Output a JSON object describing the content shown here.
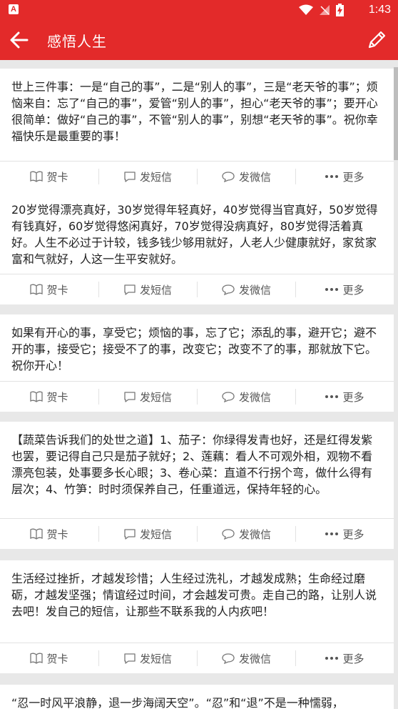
{
  "status_bar": {
    "app_badge": "A",
    "time": "1:43"
  },
  "app_bar": {
    "title": "感悟人生",
    "back_icon": "arrow-left-icon",
    "edit_icon": "pencil-icon"
  },
  "actions": {
    "card": "贺卡",
    "sms": "发短信",
    "wechat": "发微信",
    "more": "更多"
  },
  "posts": [
    {
      "text": "世上三件事：一是“自己的事”，二是“别人的事”，三是“老天爷的事”；烦恼来自：忘了“自己的事”，爱管“别人的事”，担心“老天爷的事”；要开心很简单：做好“自己的事”，不管“别人的事”，别想“老天爷的事”。祝你幸福快乐是最重要的事！"
    },
    {
      "text": "20岁觉得漂亮真好，30岁觉得年轻真好，40岁觉得当官真好，50岁觉得有钱真好，60岁觉得悠闲真好，70岁觉得没病真好，80岁觉得活着真好。人生不必过于计较，钱多钱少够用就好，人老人少健康就好，家贫家富和气就好，人这一生平安就好。"
    },
    {
      "text": "如果有开心的事，享受它；烦恼的事，忘了它；添乱的事，避开它；避不开的事，接受它；接受不了的事，改变它；改变不了的事，那就放下它。祝你开心！"
    },
    {
      "text": "【蔬菜告诉我们的处世之道】1、茄子：你绿得发青也好，还是红得发紫也罢，要记得自己只是茄子就好；2、莲藕：看人不可观外相，观物不看漂亮包装，处事要多长心眼；3、卷心菜：直道不行拐个弯，做什么得有层次；4、竹笋：时时须保养自己，任重道远，保持年轻的心。"
    },
    {
      "text": "生活经过挫折，才越发珍惜；人生经过洗礼，才越发成熟；生命经过磨砺，才越发坚强；情谊经过时间，才会越发可贵。走自己的路，让别人说去吧！发自己的短信，让那些不联系我的人内疚吧！"
    },
    {
      "text": "“忍一时风平浪静，退一步海阔天空”。“忍”和“退”不是一种懦弱，"
    }
  ],
  "colors": {
    "primary": "#e32a2a",
    "background": "#e8e8e8",
    "card": "#ffffff"
  }
}
